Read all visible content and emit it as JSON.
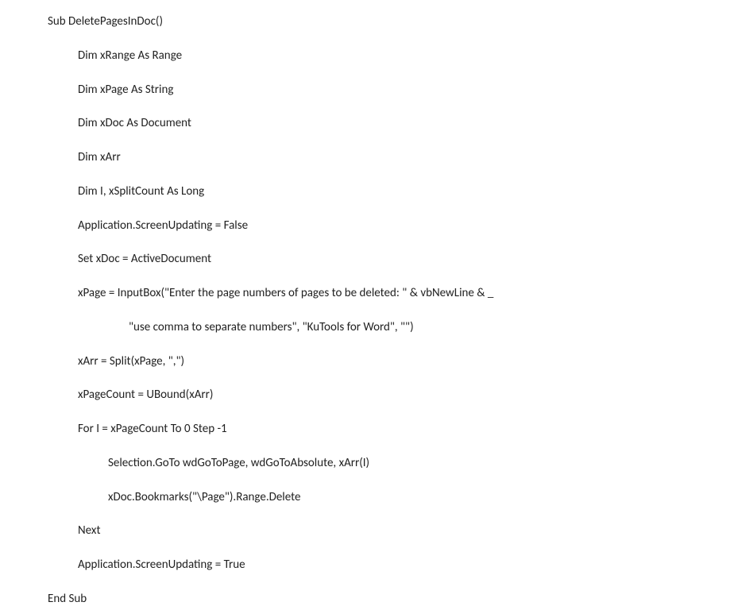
{
  "code": {
    "l01": "Sub DeletePagesInDoc()",
    "l02": "Dim xRange As Range",
    "l03": "Dim xPage As String",
    "l04": "Dim xDoc As Document",
    "l05": "Dim xArr",
    "l06": "Dim I, xSplitCount As Long",
    "l07": "Application.ScreenUpdating = False",
    "l08": "Set xDoc = ActiveDocument",
    "l09": "xPage = InputBox(\"Enter the page numbers of pages to be deleted: \" & vbNewLine & _",
    "l10": "\"use comma to separate numbers\", \"KuTools for Word\", \"\")",
    "l11": "xArr = Split(xPage, \",\")",
    "l12": "xPageCount = UBound(xArr)",
    "l13": "For I = xPageCount To 0 Step -1",
    "l14": "Selection.GoTo wdGoToPage, wdGoToAbsolute, xArr(I)",
    "l15": "xDoc.Bookmarks(\"\\Page\").Range.Delete",
    "l16": "Next",
    "l17": "Application.ScreenUpdating = True",
    "l18": "End Sub"
  }
}
